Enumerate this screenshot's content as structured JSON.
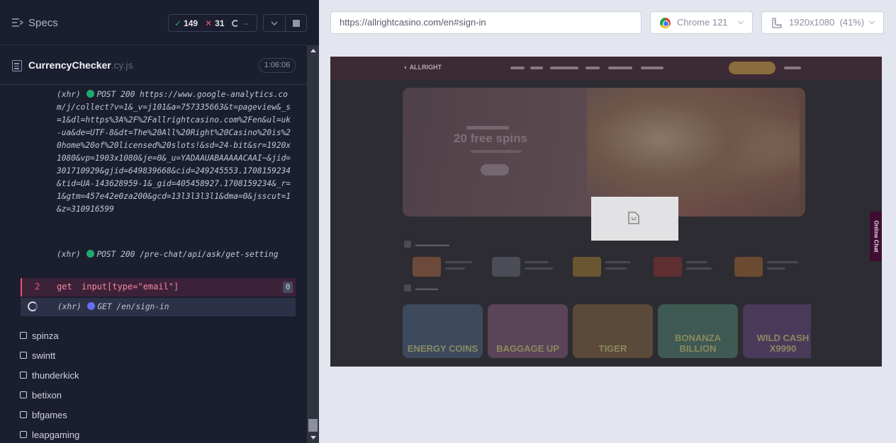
{
  "specs_panel": {
    "title": "Specs",
    "stats": {
      "passed": "149",
      "failed": "31",
      "pending": "--"
    }
  },
  "spec_file": {
    "name": "CurrencyChecker",
    "ext": ".cy.js",
    "duration": "1:06:06"
  },
  "command_log": {
    "xhr1": {
      "tag": "(xhr)",
      "method": "POST",
      "status": "200",
      "url": "https://www.google-analytics.com/j/collect?v=1&_v=j101&a=757335663&t=pageview&_s=1&dl=https%3A%2F%2Fallrightcasino.com%2Fen&ul=uk-ua&de=UTF-8&dt=The%20All%20Right%20Casino%20is%20home%20of%20licensed%20slots!&sd=24-bit&sr=1920x1080&vp=1903x1080&je=0&_u=YADAAUABAAAAACAAI~&jid=301710929&gjid=649839668&cid=249245553.1708159234&tid=UA-143628959-1&_gid=405458927.1708159234&_r=1&gtm=457e42e0za200&gcd=13l3l3l3l1&dma=0&jsscut=1&z=310916599"
    },
    "xhr2": {
      "tag": "(xhr)",
      "method": "POST",
      "status": "200",
      "url": "/pre-chat/api/ask/get-setting"
    },
    "failed_command": {
      "number": "2",
      "name": "get",
      "arg": "input[type=\"email\"]",
      "badge": "0"
    },
    "pending_xhr": {
      "tag": "(xhr)",
      "method": "GET",
      "url": "/en/sign-in"
    }
  },
  "spec_list": [
    "spinza",
    "swintt",
    "thunderkick",
    "betixon",
    "bfgames",
    "leapgaming"
  ],
  "browser_toolbar": {
    "url": "https://allrightcasino.com/en#sign-in",
    "browser": "Chrome 121",
    "viewport": "1920x1080",
    "scale": "(41%)"
  },
  "aut": {
    "hero_title": "20 free spins",
    "online_chat": "Online Chat",
    "games": [
      "ENERGY COINS",
      "BAGGAGE UP",
      "TIGER",
      "BONANZA BILLION",
      "WILD CASH X9990"
    ]
  },
  "colors": {
    "pass": "#1fa971",
    "fail": "#e45770",
    "xhr_dot_green": "#1fa971",
    "xhr_dot_blue": "#6470f3"
  }
}
